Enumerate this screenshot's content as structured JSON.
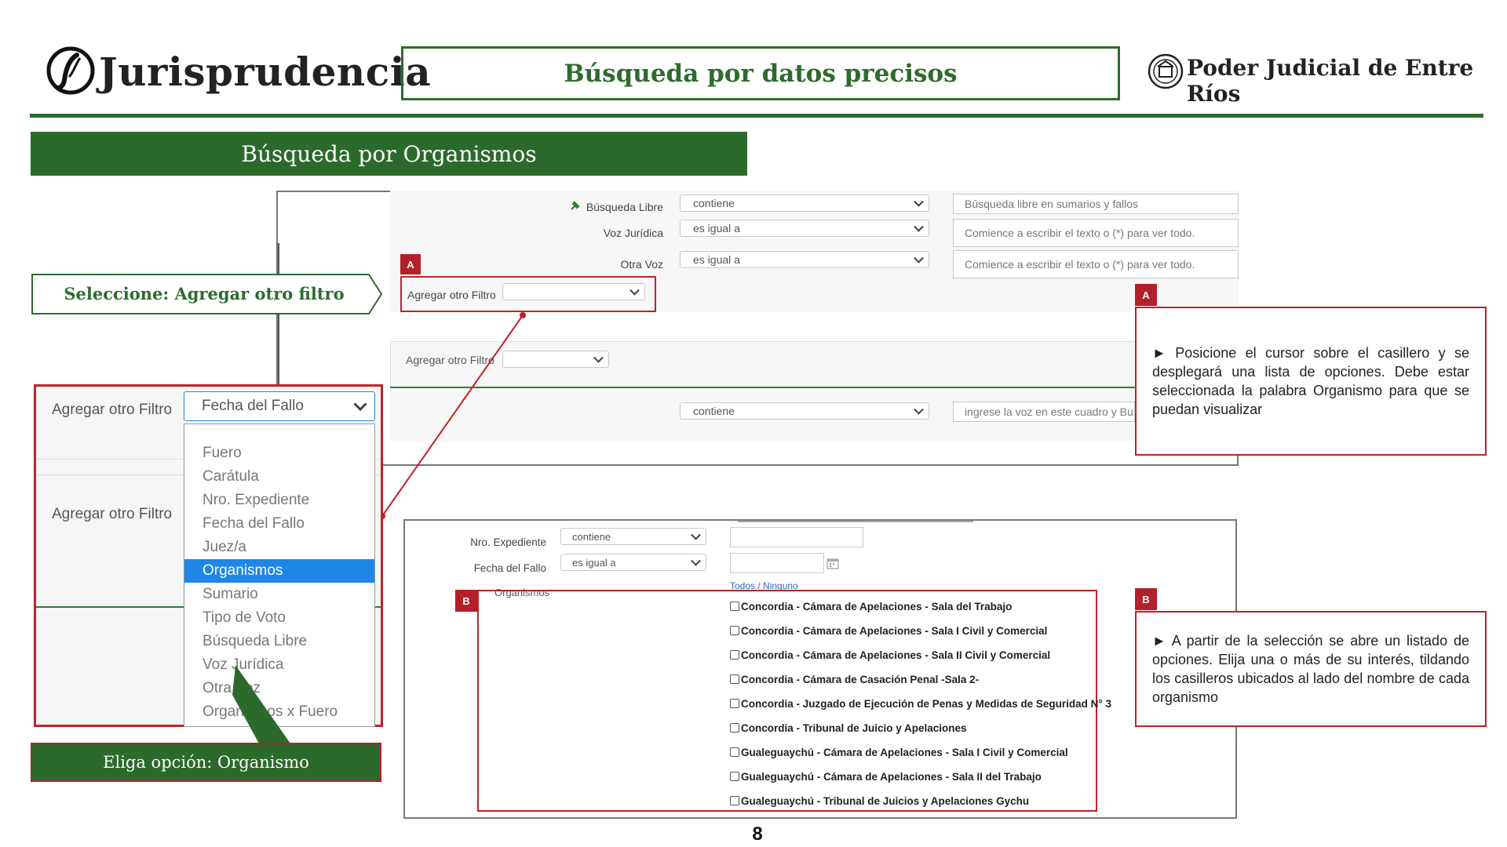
{
  "header": {
    "brand_title": "Jurisprudencia",
    "center_title": "Búsqueda por datos precisos",
    "org_title": "Poder Judicial de Entre Ríos"
  },
  "section_banner": "Búsqueda por Organismos",
  "callouts": {
    "select_filter": "Seleccione: Agregar otro filtro",
    "choose_option": "Eliga opción: Organismo"
  },
  "top_form": {
    "rows": [
      {
        "label": "Búsqueda Libre",
        "operator": "contiene",
        "placeholder": "Búsqueda libre en sumarios y fallos"
      },
      {
        "label": "Voz Jurídica",
        "operator": "es igual a",
        "placeholder": "Comience a escribir el texto o (*) para ver todo."
      },
      {
        "label": "Otra Voz",
        "operator": "es igual a",
        "placeholder": "Comience a escribir el texto o (*) para ver todo."
      }
    ],
    "add_filter_label": "Agregar otro Filtro",
    "add_filter_label_2": "Agregar otro Filtro",
    "row4_operator": "contiene",
    "row4_placeholder": "ingrese la voz en este cuadro y Bu"
  },
  "badges": {
    "a": "A",
    "b": "B"
  },
  "zoom": {
    "label_1": "Agregar otro Filtro",
    "label_2": "Agregar otro Filtro",
    "selected_value": "Fecha del Fallo",
    "options": [
      "Fuero",
      "Carátula",
      "Nro. Expediente",
      "Fecha del Fallo",
      "Juez/a",
      "Organismos",
      "Sumario",
      "Tipo de Voto",
      "Búsqueda Libre",
      "Voz Jurídica",
      "Otra Voz",
      "Organismos x Fuero"
    ],
    "selected_index": 5
  },
  "bottom_form": {
    "row1": {
      "label": "Nro. Expediente",
      "operator": "contiene"
    },
    "row2": {
      "label": "Fecha del Fallo",
      "operator": "es igual a"
    },
    "organismos_label": "Organismos",
    "todos_ninguno": "Todos / Ninguno",
    "organismos": [
      "Concordia - Cámara de Apelaciones - Sala del Trabajo",
      "Concordia - Cámara de Apelaciones - Sala I Civil y Comercial",
      "Concordia - Cámara de Apelaciones - Sala II Civil y Comercial",
      "Concordia - Cámara de Casación Penal -Sala 2-",
      "Concordia - Juzgado de Ejecución de Penas y Medidas de Seguridad N° 3",
      "Concordia - Tribunal de Juicio y Apelaciones",
      "Gualeguaychú - Cámara de Apelaciones - Sala I Civil y Comercial",
      "Gualeguaychú - Cámara de Apelaciones - Sala II del Trabajo",
      "Gualeguaychú - Tribunal de Juicios y Apelaciones Gychu"
    ]
  },
  "info": {
    "a": "► Posicione el cursor sobre el casillero y se desplegará una lista de opciones. Debe estar seleccionada la palabra Organismo para que se puedan visualizar",
    "b": "► A partir de la selección se abre un listado de opciones. Elija una o más de su interés, tildando los casilleros ubicados al lado del nombre de cada organismo"
  },
  "page_number": "8",
  "colors": {
    "green": "#2c6a2c",
    "red": "#c0222a",
    "highlight": "#1e86e6"
  }
}
